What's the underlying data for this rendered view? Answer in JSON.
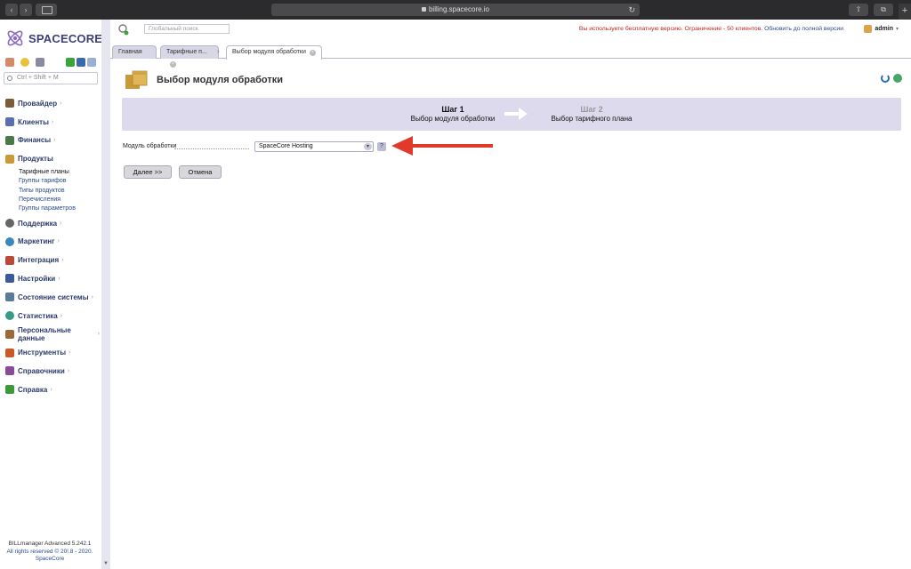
{
  "browser": {
    "url": "billing.spacecore.io",
    "back_glyph": "‹",
    "forward_glyph": "›",
    "reload_glyph": "↻",
    "share_glyph": "⇧",
    "tabs_glyph": "⧉",
    "new_tab_glyph": "+"
  },
  "brand": {
    "name": "SPACECORE",
    "accent": "#3b3f7a",
    "logo_color": "#8a6bbf"
  },
  "sidebar": {
    "search_placeholder": "Ctrl + Shift + M",
    "menu": [
      {
        "label": "Провайдер",
        "icon": "provider-icon",
        "color": "#7a5c3a"
      },
      {
        "label": "Клиенты",
        "icon": "clients-icon",
        "color": "#5a6fae"
      },
      {
        "label": "Финансы",
        "icon": "finance-icon",
        "color": "#4a7a4a"
      },
      {
        "label": "Продукты",
        "icon": "products-icon",
        "color": "#c99a3a",
        "expanded": true,
        "children": [
          "Тарифные планы",
          "Группы тарифов",
          "Типы продуктов",
          "Перечисления",
          "Группы параметров"
        ],
        "active_child": "Тарифные планы"
      },
      {
        "label": "Поддержка",
        "icon": "support-icon",
        "color": "#666"
      },
      {
        "label": "Маркетинг",
        "icon": "marketing-icon",
        "color": "#3a88b8"
      },
      {
        "label": "Интеграция",
        "icon": "integration-icon",
        "color": "#b84a3a"
      },
      {
        "label": "Настройки",
        "icon": "settings-icon",
        "color": "#3a5a9a"
      },
      {
        "label": "Состояние системы",
        "icon": "system-state-icon",
        "color": "#5a7a9a"
      },
      {
        "label": "Статистика",
        "icon": "statistics-icon",
        "color": "#3a9a8a"
      },
      {
        "label": "Персональные данные",
        "icon": "personal-data-icon",
        "color": "#9a6a3a"
      },
      {
        "label": "Инструменты",
        "icon": "tools-icon",
        "color": "#c85a2a"
      },
      {
        "label": "Справочники",
        "icon": "references-icon",
        "color": "#8a4a9a"
      },
      {
        "label": "Справка",
        "icon": "help-icon",
        "color": "#3a9a3a"
      }
    ],
    "footer_version": "BILLmanager Advanced 5.242.1",
    "footer_copyright": "All rights reserved © 20!.8 - 2020.",
    "footer_company": "SpaceCore"
  },
  "topbar": {
    "global_search_placeholder": "Глобальный поиск",
    "warning": "Вы используете бесплатную версию. Ограничение - 50 клиентов.",
    "upgrade_link": "Обновить до полной версии",
    "user": "admin"
  },
  "tabs": [
    {
      "label": "Главная"
    },
    {
      "label": "Тарифные п..."
    },
    {
      "label": "Выбор модуля обработки",
      "active": true
    }
  ],
  "page": {
    "title": "Выбор модуля обработки",
    "wizard": {
      "step1": {
        "title": "Шаг 1",
        "desc": "Выбор модуля обработки"
      },
      "step2": {
        "title": "Шаг 2",
        "desc": "Выбор тарифного плана"
      }
    },
    "field_label": "Модуль обработки",
    "field_value": "SpaceCore Hosting",
    "help_glyph": "?",
    "next_label": "Далее >>",
    "cancel_label": "Отмена"
  },
  "colors": {
    "wizard_bg": "#dcdaec",
    "warning": "#c0261f",
    "annotation_arrow": "#e23a2a"
  }
}
